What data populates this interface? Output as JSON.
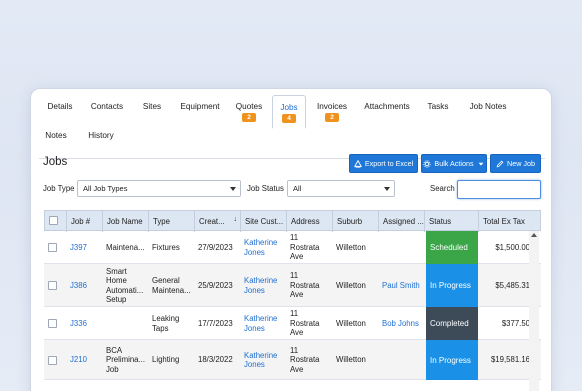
{
  "tabs": [
    {
      "label": "Details",
      "badge": null
    },
    {
      "label": "Contacts",
      "badge": null
    },
    {
      "label": "Sites",
      "badge": null
    },
    {
      "label": "Equipment",
      "badge": null
    },
    {
      "label": "Quotes",
      "badge": "2"
    },
    {
      "label": "Jobs",
      "badge": "4"
    },
    {
      "label": "Invoices",
      "badge": "2"
    },
    {
      "label": "Attachments",
      "badge": null
    },
    {
      "label": "Tasks",
      "badge": null
    },
    {
      "label": "Job Notes",
      "badge": null
    },
    {
      "label": "Notes",
      "badge": null
    },
    {
      "label": "History",
      "badge": null
    }
  ],
  "page_title": "Jobs",
  "buttons": {
    "export": "Export to Excel",
    "bulk": "Bulk Actions",
    "new_job": "New Job"
  },
  "filters": {
    "job_type_label": "Job Type",
    "job_type_value": "All Job Types",
    "job_status_label": "Job Status",
    "job_status_value": "All",
    "search_label": "Search",
    "search_value": ""
  },
  "columns": [
    "Job #",
    "Job Name",
    "Type",
    "Creat...",
    "Site Cust...",
    "Address",
    "Suburb",
    "Assigned ...",
    "Status",
    "Total Ex Tax"
  ],
  "rows": [
    {
      "job": "J397",
      "name": "Maintena...",
      "type": "Fixtures",
      "created": "27/9/2023",
      "site": "Katherine Jones",
      "address": "11 Rostrata Ave",
      "suburb": "Willetton",
      "assigned": "",
      "status": "Scheduled",
      "total": "$1,500.00"
    },
    {
      "job": "J386",
      "name": "Smart Home Automati... Setup",
      "type": "General Maintena...",
      "created": "25/9/2023",
      "site": "Katherine Jones",
      "address": "11 Rostrata Ave",
      "suburb": "Willetton",
      "assigned": "Paul Smith",
      "status": "In Progress",
      "total": "$5,485.31"
    },
    {
      "job": "J336",
      "name": "",
      "type": "Leaking Taps",
      "created": "17/7/2023",
      "site": "Katherine Jones",
      "address": "11 Rostrata Ave",
      "suburb": "Willetton",
      "assigned": "Bob Johns",
      "status": "Completed",
      "total": "$377.50"
    },
    {
      "job": "J210",
      "name": "BCA Prelimina... Job",
      "type": "Lighting",
      "created": "18/3/2022",
      "site": "Katherine Jones",
      "address": "11 Rostrata Ave",
      "suburb": "Willetton",
      "assigned": "",
      "status": "In Progress",
      "total": "$19,581.16"
    }
  ],
  "status_colors": {
    "Scheduled": "#3aa648",
    "In Progress": "#1a90e6",
    "Completed": "#3d4a58"
  },
  "accent_color": "#1f78d8",
  "badge_color": "#f0921e"
}
